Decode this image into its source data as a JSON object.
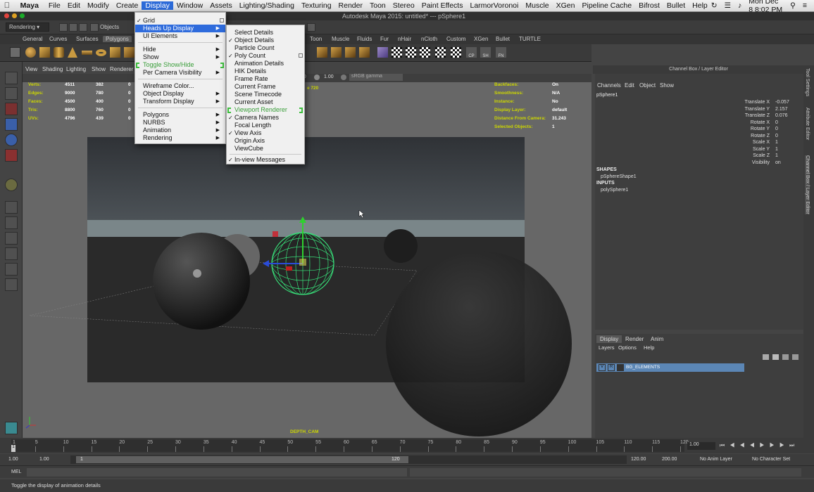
{
  "mac_menubar": {
    "app": "Maya",
    "items": [
      "File",
      "Edit",
      "Modify",
      "Create",
      "Display",
      "Window",
      "Assets",
      "Lighting/Shading",
      "Texturing",
      "Render",
      "Toon",
      "Stereo",
      "Paint Effects",
      "LarmorVoronoi",
      "Muscle",
      "XGen",
      "Pipeline Cache",
      "Bifrost",
      "Bullet",
      "Help"
    ],
    "active": "Display",
    "clock": "Mon Dec 8  8:02 PM"
  },
  "window": {
    "title": "Autodesk Maya 2015: untitled*   ---   pSphere1"
  },
  "statusline": {
    "menuset": "Rendering",
    "selection_mode": "Objects"
  },
  "shelf": {
    "tabs": [
      "General",
      "Curves",
      "Surfaces",
      "Polygons",
      "Toon",
      "Muscle",
      "Fluids",
      "Fur",
      "nHair",
      "nCloth",
      "Custom",
      "XGen",
      "Bullet",
      "TURTLE"
    ],
    "active_tab": "Polygons",
    "labels": [
      "CP",
      "SH",
      "FN"
    ]
  },
  "panel": {
    "menu": [
      "View",
      "Shading",
      "Lighting",
      "Show",
      "Renderer"
    ],
    "gamma_value": "1.00",
    "color_space": "sRGB gamma",
    "field_value": "00"
  },
  "hud": {
    "poly_rows": [
      {
        "label": "Verts:",
        "a": "4511",
        "b": "382",
        "c": "0"
      },
      {
        "label": "Edges:",
        "a": "9000",
        "b": "780",
        "c": "0"
      },
      {
        "label": "Faces:",
        "a": "4500",
        "b": "400",
        "c": "0"
      },
      {
        "label": "Tris:",
        "a": "8800",
        "b": "760",
        "c": "0"
      },
      {
        "label": "UVs:",
        "a": "4796",
        "b": "439",
        "c": "0"
      }
    ],
    "resolution_fragment": "e 720",
    "object_rows": [
      {
        "label": "Backfaces:",
        "value": "On"
      },
      {
        "label": "Smoothness:",
        "value": "N/A"
      },
      {
        "label": "Instance:",
        "value": "No"
      },
      {
        "label": "Display Layer:",
        "value": "default"
      },
      {
        "label": "Distance From Camera:",
        "value": "31.243"
      },
      {
        "label": "Selected Objects:",
        "value": "1"
      }
    ],
    "camera_name": "DEPTH_CAM"
  },
  "display_menu": {
    "items": [
      {
        "label": "Grid",
        "check": true
      },
      {
        "label": "Heads Up Display",
        "submenu": true,
        "highlight": true
      },
      {
        "label": "UI Elements",
        "submenu": true
      },
      {
        "label": "Hide",
        "submenu": true
      },
      {
        "label": "Show",
        "submenu": true
      },
      {
        "label": "Toggle Show/Hide",
        "green": true
      },
      {
        "label": "Per Camera Visibility",
        "submenu": true
      },
      {
        "label": "Wireframe Color..."
      },
      {
        "label": "Object Display",
        "submenu": true
      },
      {
        "label": "Transform Display",
        "submenu": true
      },
      {
        "label": "Polygons",
        "submenu": true
      },
      {
        "label": "NURBS",
        "submenu": true
      },
      {
        "label": "Animation",
        "submenu": true
      },
      {
        "label": "Rendering",
        "submenu": true
      }
    ]
  },
  "hud_submenu": {
    "items": [
      {
        "label": "Select Details",
        "check": false
      },
      {
        "label": "Object Details",
        "check": true
      },
      {
        "label": "Particle Count",
        "check": false
      },
      {
        "label": "Poly Count",
        "check": true
      },
      {
        "label": "Animation Details",
        "check": false
      },
      {
        "label": "HIK Details",
        "check": false
      },
      {
        "label": "Frame Rate",
        "check": false
      },
      {
        "label": "Current Frame",
        "check": false
      },
      {
        "label": "Scene Timecode",
        "check": false
      },
      {
        "label": "Current Asset",
        "check": false
      },
      {
        "label": "Viewport Renderer",
        "check": false,
        "green": true
      },
      {
        "label": "Camera Names",
        "check": true
      },
      {
        "label": "Focal Length",
        "check": false
      },
      {
        "label": "View Axis",
        "check": true
      },
      {
        "label": "Origin Axis",
        "check": false
      },
      {
        "label": "ViewCube",
        "check": false
      },
      {
        "label": "In-view Messages",
        "check": true
      }
    ]
  },
  "channel_box": {
    "title": "Channel Box / Layer Editor",
    "menu": [
      "Channels",
      "Edit",
      "Object",
      "Show"
    ],
    "node": "pSphere1",
    "attributes": [
      {
        "name": "Translate X",
        "value": "-0.057"
      },
      {
        "name": "Translate Y",
        "value": "2.157"
      },
      {
        "name": "Translate Z",
        "value": "0.076"
      },
      {
        "name": "Rotate X",
        "value": "0"
      },
      {
        "name": "Rotate Y",
        "value": "0"
      },
      {
        "name": "Rotate Z",
        "value": "0"
      },
      {
        "name": "Scale X",
        "value": "1"
      },
      {
        "name": "Scale Y",
        "value": "1"
      },
      {
        "name": "Scale Z",
        "value": "1"
      },
      {
        "name": "Visibility",
        "value": "on"
      }
    ],
    "shapes_header": "SHAPES",
    "shape_node": "pSphereShape1",
    "inputs_header": "INPUTS",
    "input_node": "polySphere1"
  },
  "side_tabs": [
    "Tool Settings",
    "Attribute Editor",
    "Channel Box / Layer Editor"
  ],
  "layer_editor": {
    "tabs": [
      "Display",
      "Render",
      "Anim"
    ],
    "active_tab": "Display",
    "menu": [
      "Layers",
      "Options",
      "Help"
    ],
    "layer": {
      "v": "V",
      "r": "R",
      "name": "BG_ELEMENTS"
    }
  },
  "timeline": {
    "ticks": [
      "1",
      "5",
      "10",
      "15",
      "20",
      "25",
      "30",
      "35",
      "40",
      "45",
      "50",
      "55",
      "60",
      "65",
      "70",
      "75",
      "80",
      "85",
      "90",
      "95",
      "100",
      "105",
      "110",
      "115",
      "120"
    ],
    "current_frame": "1.00"
  },
  "range": {
    "start": "1.00",
    "anim_start": "1.00",
    "slider_start": "1",
    "slider_end": "120",
    "end": "120.00",
    "anim_end": "200.00",
    "anim_layer": "No Anim Layer",
    "char_set": "No Character Set"
  },
  "mel": {
    "label": "MEL"
  },
  "help_line": "Toggle the display of animation details"
}
